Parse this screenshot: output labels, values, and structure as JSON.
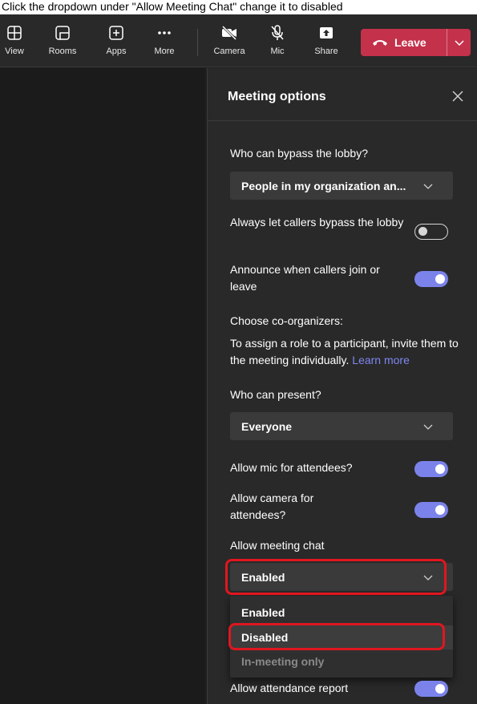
{
  "instruction": "Click the dropdown under \"Allow Meeting Chat\" change it to disabled",
  "toolbar": {
    "view": "View",
    "rooms": "Rooms",
    "apps": "Apps",
    "more": "More",
    "camera": "Camera",
    "mic": "Mic",
    "share": "Share",
    "leave": "Leave"
  },
  "panel": {
    "title": "Meeting options",
    "lobby_label": "Who can bypass the lobby?",
    "lobby_value": "People in my organization an...",
    "callers_bypass_label": "Always let callers bypass the lobby",
    "callers_bypass_on": false,
    "announce_label": "Announce when callers join or leave",
    "announce_on": true,
    "coorganizers_label": "Choose co-organizers:",
    "assign_text": "To assign a role to a participant, invite them to the meeting individually.",
    "learn_more": "Learn more",
    "present_label": "Who can present?",
    "present_value": "Everyone",
    "mic_label": "Allow mic for attendees?",
    "mic_on": true,
    "camera_label": "Allow camera for attendees?",
    "camera_on": true,
    "chat_label": "Allow meeting chat",
    "chat_value": "Enabled",
    "chat_options": [
      "Enabled",
      "Disabled",
      "In-meeting only"
    ],
    "attendance_label": "Allow attendance report",
    "attendance_on": true
  },
  "colors": {
    "accent": "#7b83eb",
    "leave": "#c4314b",
    "highlight": "#e0161f"
  }
}
